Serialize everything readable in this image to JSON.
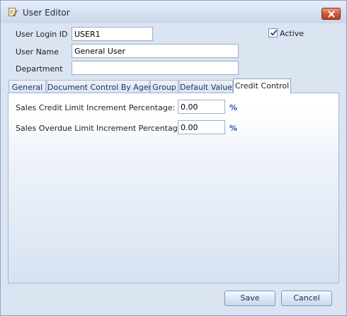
{
  "window": {
    "title": "User Editor",
    "title_icon": "edit-document-icon",
    "close_icon": "close-icon"
  },
  "form": {
    "login_id_label": "User Login ID",
    "login_id_value": "USER1",
    "active_label": "Active",
    "active_checked": true,
    "user_name_label": "User Name",
    "user_name_value": "General User",
    "department_label": "Department",
    "department_value": ""
  },
  "tabs": [
    {
      "label": "General",
      "active": false
    },
    {
      "label": "Document Control By Agent",
      "active": false
    },
    {
      "label": "Group",
      "active": false
    },
    {
      "label": "Default Value",
      "active": false
    },
    {
      "label": "Credit Control",
      "active": true
    }
  ],
  "credit_control": {
    "sales_credit_label": "Sales Credit Limit Increment Percentage:",
    "sales_credit_value": "0.00",
    "sales_overdue_label": "Sales Overdue Limit Increment Percentage:",
    "sales_overdue_value": "0.00",
    "unit": "%"
  },
  "buttons": {
    "save": "Save",
    "cancel": "Cancel"
  },
  "colors": {
    "accent_percent": "#1d54c8",
    "close_button": "#c13f22"
  }
}
